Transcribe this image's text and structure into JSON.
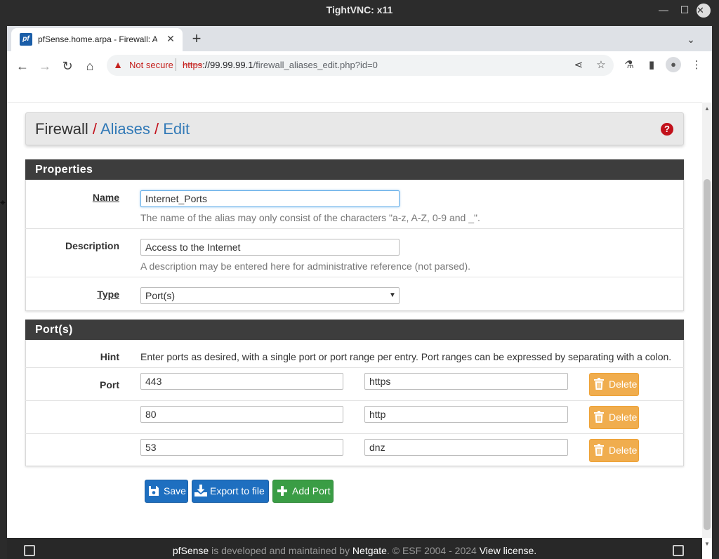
{
  "window": {
    "title": "TightVNC: x11"
  },
  "browser": {
    "tab_title": "pfSense.home.arpa - Firewall: Aliases",
    "favicon_text": "pf",
    "security_label": "Not secure",
    "url_scheme": "https",
    "url_rest": "://99.99.99.1",
    "url_path": "/firewall_aliases_edit.php?id=0"
  },
  "breadcrumb": {
    "root": "Firewall",
    "sep": "/",
    "level1": "Aliases",
    "level2": "Edit"
  },
  "properties": {
    "heading": "Properties",
    "name_label": "Name",
    "name_value": "Internet_Ports",
    "name_help": "The name of the alias may only consist of the characters \"a-z, A-Z, 0-9 and _\".",
    "description_label": "Description",
    "description_value": "Access to the Internet",
    "description_help": "A description may be entered here for administrative reference (not parsed).",
    "type_label": "Type",
    "type_value": "Port(s)"
  },
  "ports": {
    "heading": "Port(s)",
    "hint_label": "Hint",
    "hint_text": "Enter ports as desired, with a single port or port range per entry. Port ranges can be expressed by separating with a colon.",
    "port_label": "Port",
    "delete_label": "Delete",
    "rows": [
      {
        "port": "443",
        "description": "https"
      },
      {
        "port": "80",
        "description": "http"
      },
      {
        "port": "53",
        "description": "dnz"
      }
    ]
  },
  "actions": {
    "save": "Save",
    "export": "Export to file",
    "add_port": "Add Port"
  },
  "footer": {
    "brand": "pfSense",
    "text1": " is developed and maintained by ",
    "company": "Netgate",
    "text2": ". © ESF 2004 - 2024 ",
    "license": "View license."
  },
  "colors": {
    "breadcrumb_sep": "#c2111b",
    "link": "#337ab7",
    "panel_header": "#3d3d3d",
    "delete_button": "#f0ad4e",
    "primary_button": "#1e6fc0",
    "success_button": "#3a9d45"
  }
}
